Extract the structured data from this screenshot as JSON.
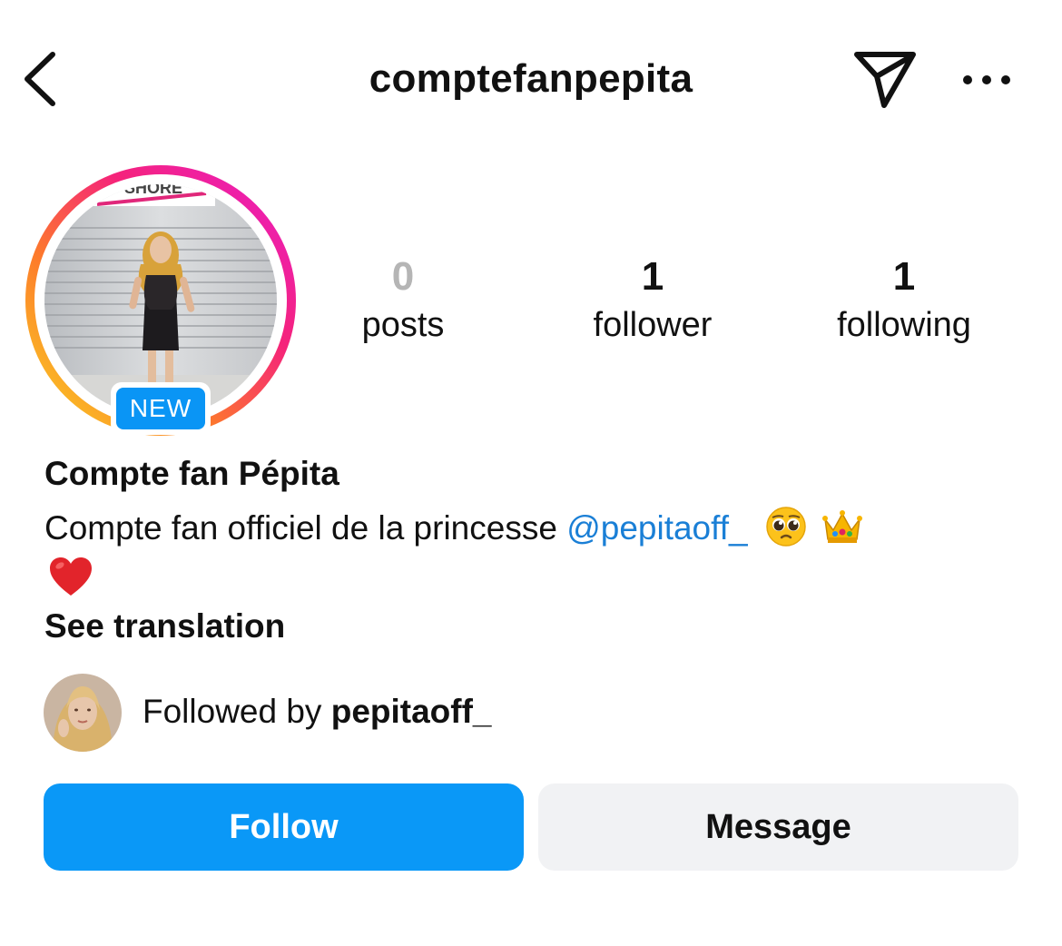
{
  "header": {
    "username": "comptefanpepita",
    "back_icon": "chevron-left-icon",
    "share_icon": "paper-plane-icon",
    "more_icon": "ellipsis-icon"
  },
  "profile": {
    "avatar_badge": "NEW",
    "photo_sign_text": "SHORE",
    "story_ring_colors": [
      "#f9d423",
      "#fd5949",
      "#d6249f",
      "#e91ec8"
    ],
    "display_name": "Compte fan Pépita",
    "bio_text": "Compte fan officiel de la princesse ",
    "bio_mention": "@pepitaoff_",
    "bio_emojis": [
      "pleading-face-emoji",
      "crown-emoji",
      "red-heart-emoji"
    ],
    "see_translation": "See translation"
  },
  "stats": {
    "posts": {
      "count": "0",
      "label": "posts"
    },
    "followers": {
      "count": "1",
      "label": "follower"
    },
    "following": {
      "count": "1",
      "label": "following"
    }
  },
  "followed_by": {
    "prefix": "Followed by ",
    "username": "pepitaoff_"
  },
  "actions": {
    "follow_label": "Follow",
    "message_label": "Message"
  },
  "colors": {
    "follow_button": "#0a98f7",
    "message_button": "#f1f2f4",
    "mention_link": "#1a7fd6",
    "badge": "#0a95f5"
  }
}
